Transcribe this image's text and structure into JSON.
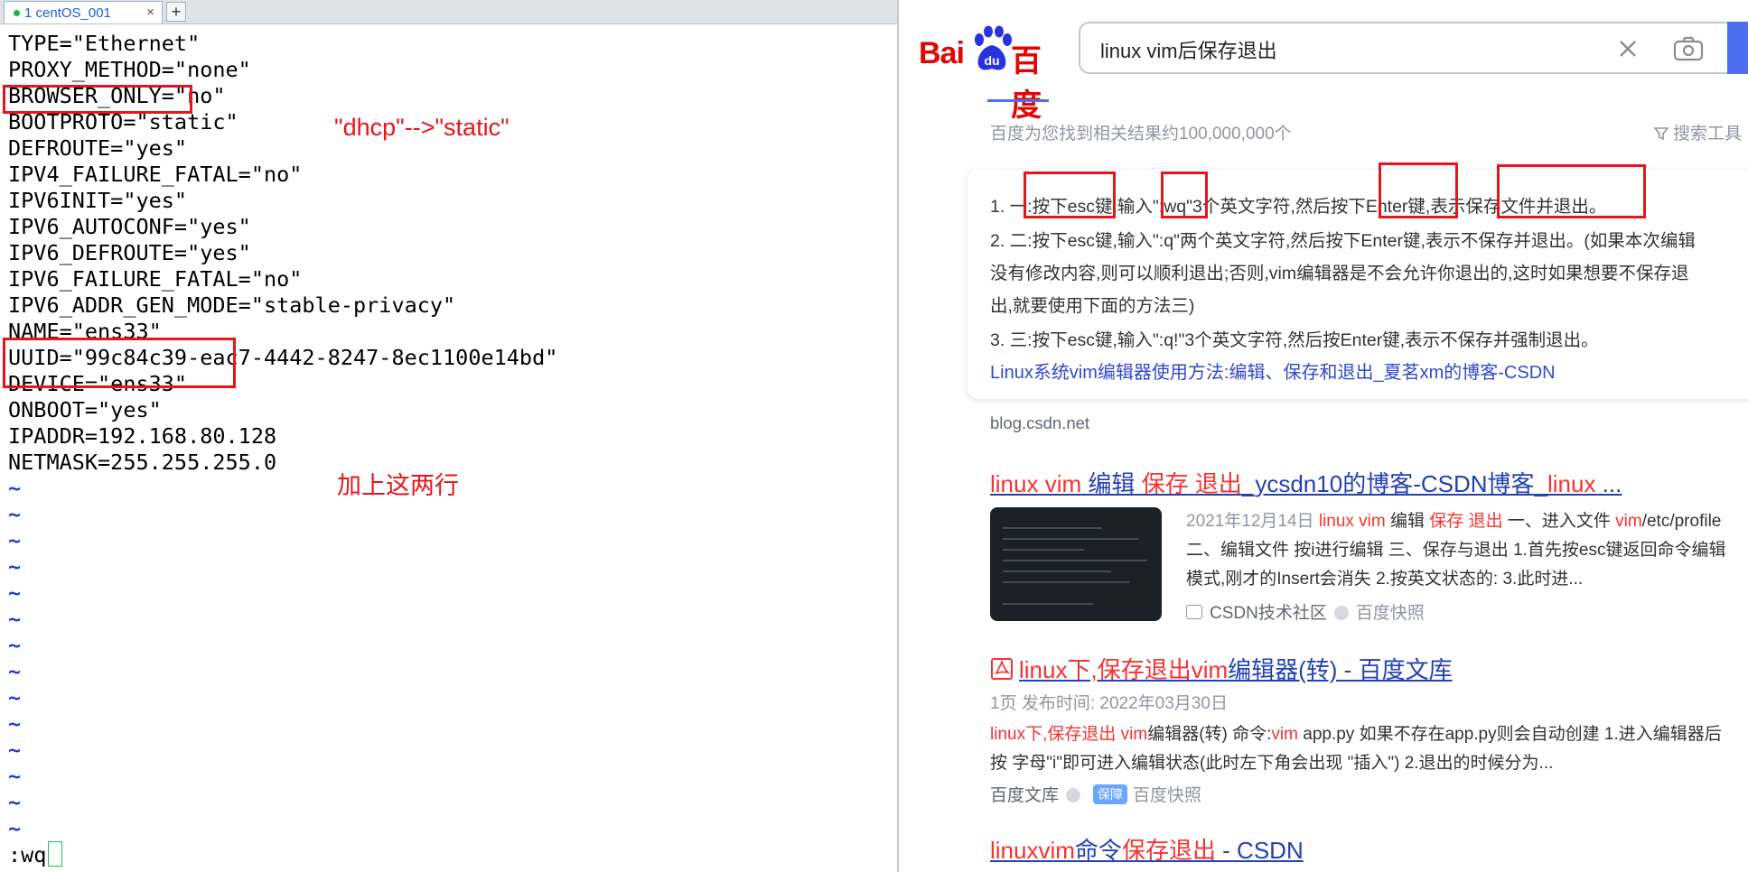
{
  "terminal": {
    "tab_label": "1 centOS_001",
    "tab_close": "×",
    "tab_add": "+",
    "lines": [
      "TYPE=\"Ethernet\"",
      "PROXY_METHOD=\"none\"",
      "BROWSER_ONLY=\"no\"",
      "BOOTPROTO=\"static\"",
      "DEFROUTE=\"yes\"",
      "IPV4_FAILURE_FATAL=\"no\"",
      "IPV6INIT=\"yes\"",
      "IPV6_AUTOCONF=\"yes\"",
      "IPV6_DEFROUTE=\"yes\"",
      "IPV6_FAILURE_FATAL=\"no\"",
      "IPV6_ADDR_GEN_MODE=\"stable-privacy\"",
      "NAME=\"ens33\"",
      "UUID=\"99c84c39-eac7-4442-8247-8ec1100e14bd\"",
      "DEVICE=\"ens33\"",
      "ONBOOT=\"yes\"",
      "IPADDR=192.168.80.128",
      "NETMASK=255.255.255.0"
    ],
    "tilde_rows": [
      "~",
      "~",
      "~",
      "~",
      "~",
      "~",
      "~",
      "~",
      "~",
      "~",
      "~",
      "~",
      "~",
      "~"
    ],
    "command": ":wq",
    "note_bootproto": "\"dhcp\"-->\"static\"",
    "note_addlines": "加上这两行"
  },
  "browser": {
    "logo_latin": "Bai",
    "logo_du": "du",
    "logo_cn": "百度",
    "search_query": "linux vim后保存退出",
    "result_count": "百度为您找到相关结果约100,000,000个",
    "search_tools": "搜索工具",
    "answer": {
      "line1": "1. 一:按下esc键,输入\":wq\"3个英文字符,然后按下Enter键,表示保存文件并退出。",
      "line2": "2. 二:按下esc键,输入\":q\"两个英文字符,然后按下Enter键,表示不保存并退出。(如果本次编辑",
      "line3": "没有修改内容,则可以顺利退出;否则,vim编辑器是不会允许你退出的,这时如果想要不保存退",
      "line4": "出,就要使用下面的方法三)",
      "line5": "3. 三:按下esc键,输入\":q!\"3个英文字符,然后按Enter键,表示不保存并强制退出。",
      "link": "Linux系统vim编辑器使用方法:编辑、保存和退出_夏茗xm的博客-CSDN",
      "source": "blog.csdn.net"
    },
    "results": [
      {
        "title_parts": [
          "linux vim",
          " ",
          "编辑",
          " ",
          "保存",
          " ",
          "退出",
          "_ycsdn10的博客-CSDN博客_",
          "linux",
          " ..."
        ],
        "date": "2021年12月14日",
        "snippet1_a": "linux vim",
        "snippet1_b": " 编辑 ",
        "snippet1_c": "保存 退出",
        "snippet1_d": " 一、进入文件 ",
        "snippet1_e": "vim",
        "snippet1_f": "/etc/profile",
        "snippet2": "二、编辑文件 按i进行编辑 三、保存与退出 1.首先按esc键返回命令编辑",
        "snippet3": "模式,刚才的Insert会消失 2.按英文状态的: 3.此时进...",
        "site": "CSDN技术社区",
        "snapshot": "百度快照"
      },
      {
        "title_parts": [
          "linux下,保存退出vim",
          "编辑器(转) - 百度文库"
        ],
        "meta": "1页 发布时间: 2022年03月30日",
        "snippet1_a": "linux下,保存退出 vim",
        "snippet1_b": "编辑器(转) 命令:",
        "snippet1_c": "vim",
        "snippet1_d": " app.py 如果不存在app.py则会自动创建 1.进入编辑器后",
        "snippet2": "按 字母\"i\"即可进入编辑状态(此时左下角会出现 \"插入\") 2.退出的时候分为...",
        "site": "百度文库",
        "badge": "保障",
        "snapshot": "百度快照"
      },
      {
        "title_parts": [
          "linuxvim",
          "命令",
          "保存退出",
          " - CSDN"
        ]
      }
    ]
  },
  "colors": {
    "annotation_red": "#e8141b",
    "baidu_red": "#e10602",
    "baidu_blue": "#4e6ef2",
    "link_blue": "#2440b3",
    "highlight_red": "#f73131",
    "vim_tilde": "#1a3fd6"
  }
}
